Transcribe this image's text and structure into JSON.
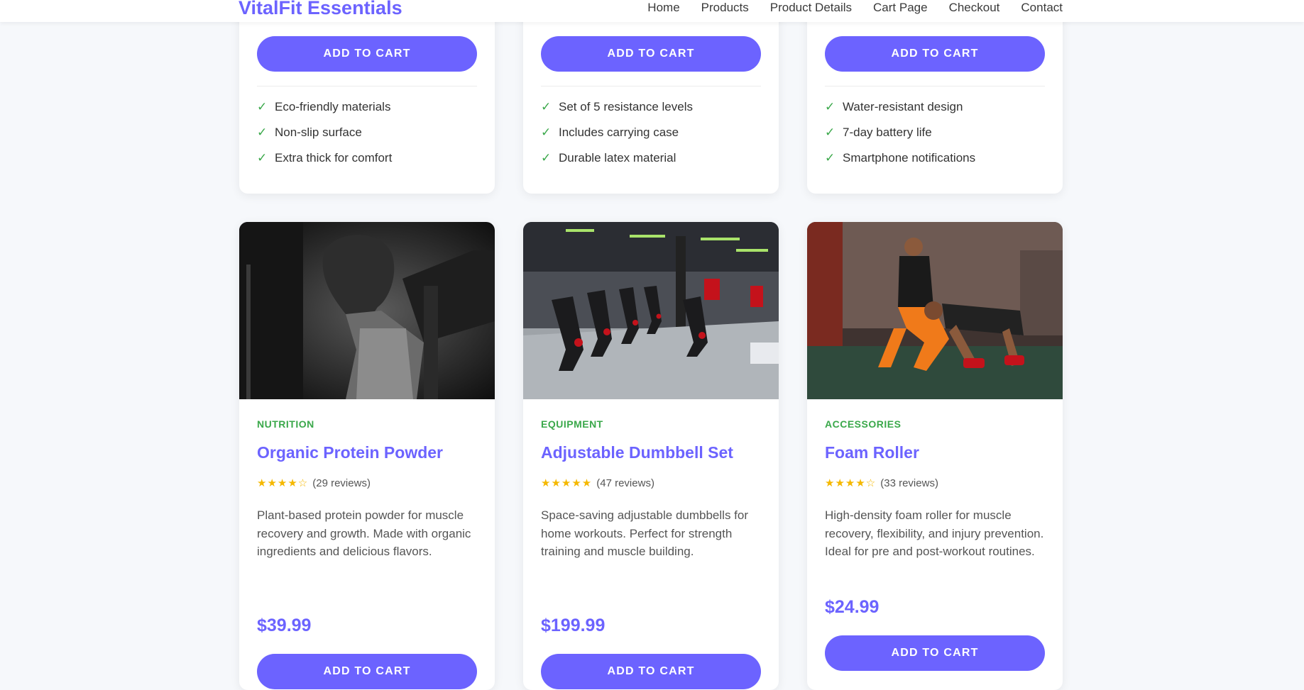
{
  "brand": "VitalFit Essentials",
  "nav": [
    "Home",
    "Products",
    "Product Details",
    "Cart Page",
    "Checkout",
    "Contact"
  ],
  "add_to_cart_label": "ADD TO CART",
  "top_cards": [
    {
      "features": [
        "Eco-friendly materials",
        "Non-slip surface",
        "Extra thick for comfort"
      ]
    },
    {
      "features": [
        "Set of 5 resistance levels",
        "Includes carrying case",
        "Durable latex material"
      ]
    },
    {
      "features": [
        "Water-resistant design",
        "7-day battery life",
        "Smartphone notifications"
      ]
    }
  ],
  "check_glyph": "✓",
  "products": [
    {
      "category": "NUTRITION",
      "title": "Organic Protein Powder",
      "stars": "★★★★☆",
      "reviews": "(29 reviews)",
      "description": "Plant-based protein powder for muscle recovery and growth. Made with organic ingredients and delicious flavors.",
      "price": "$39.99"
    },
    {
      "category": "EQUIPMENT",
      "title": "Adjustable Dumbbell Set",
      "stars": "★★★★★",
      "reviews": "(47 reviews)",
      "description": "Space-saving adjustable dumbbells for home workouts. Perfect for strength training and muscle building.",
      "price": "$199.99"
    },
    {
      "category": "ACCESSORIES",
      "title": "Foam Roller",
      "stars": "★★★★☆",
      "reviews": "(33 reviews)",
      "description": "High-density foam roller for muscle recovery, flexibility, and injury prevention. Ideal for pre and post-workout routines.",
      "price": "$24.99"
    }
  ],
  "colors": {
    "accent": "#6c63ff",
    "category_green": "#3aa84a",
    "star": "#f5b800",
    "background": "#f6f8fb"
  }
}
